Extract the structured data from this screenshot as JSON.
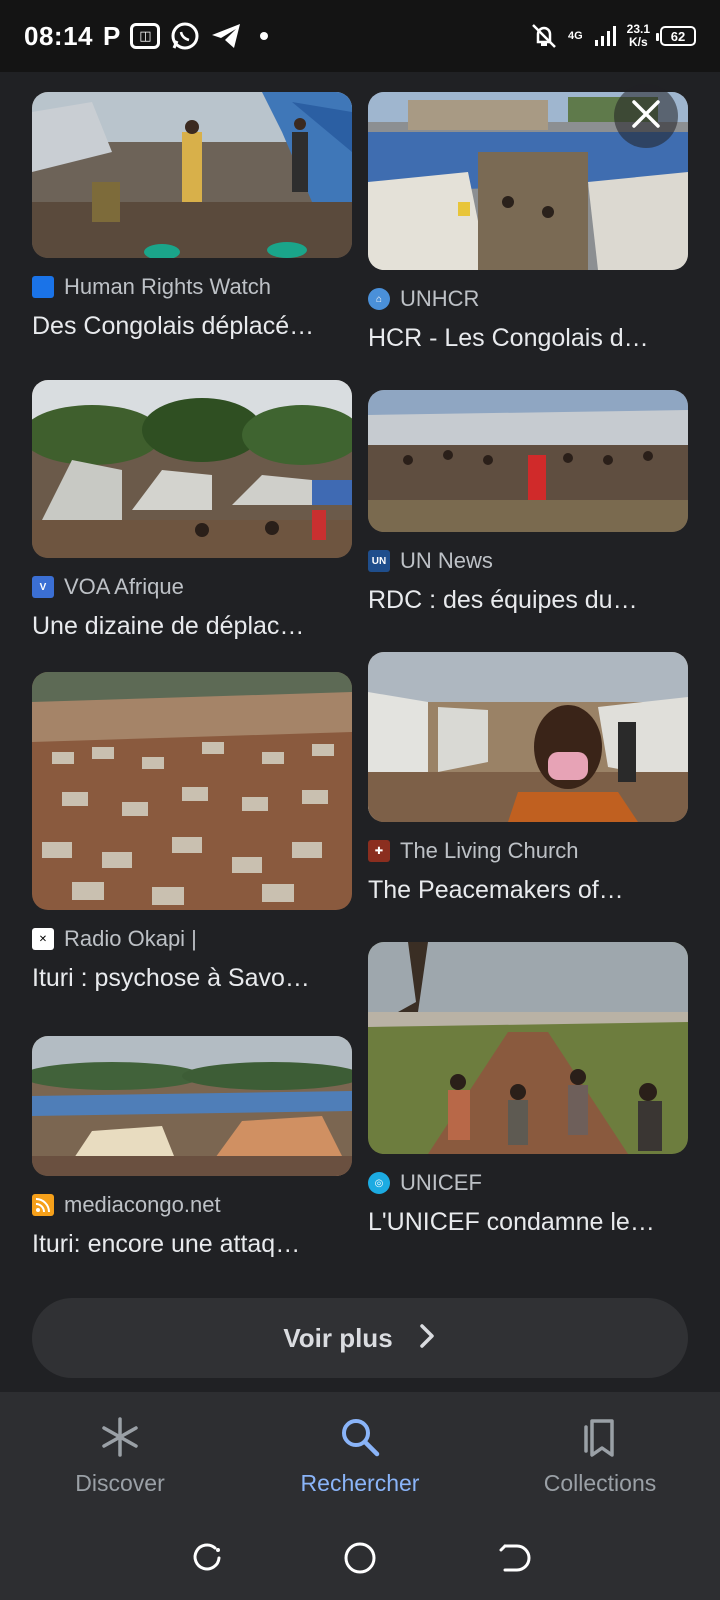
{
  "status_bar": {
    "time": "08:14",
    "net_gen": "4G",
    "speed": "23.1",
    "speed_unit": "K/s",
    "battery": "62"
  },
  "results": [
    {
      "source": "Human Rights Watch",
      "title": "Des Congolais déplacé…",
      "favicon_color": "#1a73e8",
      "icon": "hrw-favicon-icon"
    },
    {
      "source": "UNHCR",
      "title": "HCR - Les Congolais d…",
      "favicon_color": "#4a90d9",
      "icon": "unhcr-favicon-icon"
    },
    {
      "source": "VOA Afrique",
      "title": "Une dizaine de déplac…",
      "favicon_color": "#3b6fd4",
      "icon": "voa-favicon-icon"
    },
    {
      "source": "UN News",
      "title": "RDC : des équipes du…",
      "favicon_color": "#1f4e8c",
      "icon": "un-news-favicon-icon"
    },
    {
      "source": "Radio Okapi |",
      "title": "Ituri : psychose à Savo…",
      "favicon_color": "#ffffff",
      "icon": "radio-okapi-favicon-icon"
    },
    {
      "source": "The Living Church",
      "title": "The Peacemakers of…",
      "favicon_color": "#8b2e1f",
      "icon": "living-church-favicon-icon"
    },
    {
      "source": "mediacongo.net",
      "title": "Ituri: encore une attaq…",
      "favicon_color": "#f6a01a",
      "icon": "rss-favicon-icon"
    },
    {
      "source": "UNICEF",
      "title": "L'UNICEF condamne le…",
      "favicon_color": "#1cabe2",
      "icon": "unicef-favicon-icon"
    }
  ],
  "voir_plus": "Voir plus",
  "bottom_nav": [
    {
      "label": "Discover",
      "icon": "asterisk-icon",
      "active": false
    },
    {
      "label": "Rechercher",
      "icon": "search-icon",
      "active": true
    },
    {
      "label": "Collections",
      "icon": "collections-icon",
      "active": false
    }
  ],
  "colors": {
    "background": "#202124",
    "accent": "#8ab4f8",
    "muted": "#9aa0a6"
  }
}
